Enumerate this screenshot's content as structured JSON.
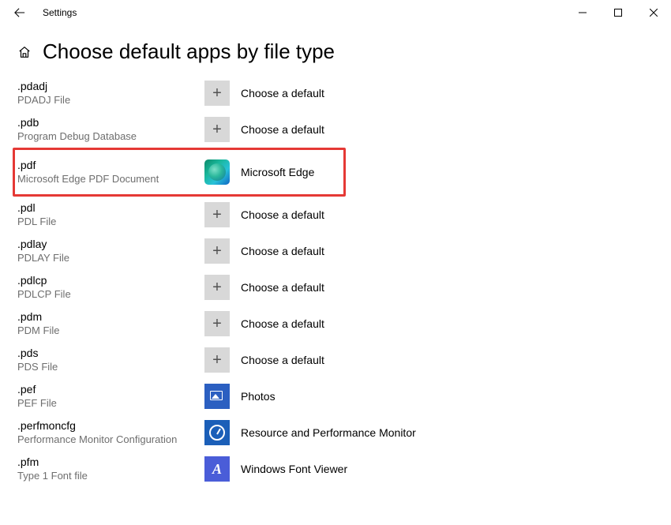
{
  "window": {
    "title": "Settings"
  },
  "page": {
    "title": "Choose default apps by file type"
  },
  "choose_default_label": "Choose a default",
  "rows": [
    {
      "ext": ".pdadj",
      "desc": "PDADJ File",
      "app": null
    },
    {
      "ext": ".pdb",
      "desc": "Program Debug Database",
      "app": null
    },
    {
      "ext": ".pdf",
      "desc": "Microsoft Edge PDF Document",
      "app": "Microsoft Edge",
      "icon": "edge",
      "highlighted": true
    },
    {
      "ext": ".pdl",
      "desc": "PDL File",
      "app": null
    },
    {
      "ext": ".pdlay",
      "desc": "PDLAY File",
      "app": null
    },
    {
      "ext": ".pdlcp",
      "desc": "PDLCP File",
      "app": null
    },
    {
      "ext": ".pdm",
      "desc": "PDM File",
      "app": null
    },
    {
      "ext": ".pds",
      "desc": "PDS File",
      "app": null
    },
    {
      "ext": ".pef",
      "desc": "PEF File",
      "app": "Photos",
      "icon": "photos"
    },
    {
      "ext": ".perfmoncfg",
      "desc": "Performance Monitor Configuration",
      "app": "Resource and Performance Monitor",
      "icon": "resmon"
    },
    {
      "ext": ".pfm",
      "desc": "Type 1 Font file",
      "app": "Windows Font Viewer",
      "icon": "font"
    }
  ]
}
